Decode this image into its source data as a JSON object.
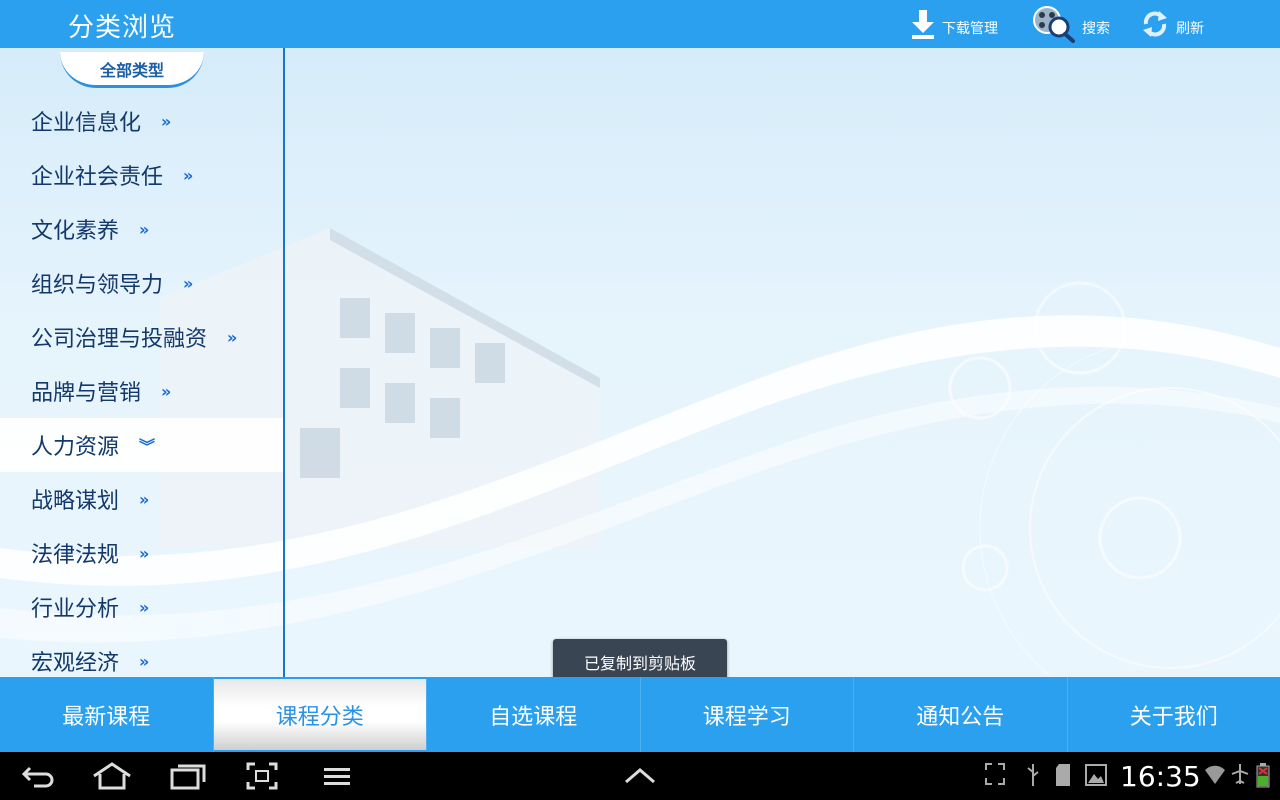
{
  "header": {
    "title": "分类浏览",
    "download_label": "下载管理",
    "search_label": "搜索",
    "refresh_label": "刷新"
  },
  "sidebar": {
    "badge": "全部类型",
    "items": [
      {
        "label": "企业信息化",
        "chevron": "»"
      },
      {
        "label": "企业社会责任",
        "chevron": "»"
      },
      {
        "label": "文化素养",
        "chevron": "»"
      },
      {
        "label": "组织与领导力",
        "chevron": "»"
      },
      {
        "label": "公司治理与投融资",
        "chevron": "»"
      },
      {
        "label": "品牌与营销",
        "chevron": "»"
      },
      {
        "label": "人力资源",
        "chevron": "︾"
      },
      {
        "label": "战略谋划",
        "chevron": "»"
      },
      {
        "label": "法律法规",
        "chevron": "»"
      },
      {
        "label": "行业分析",
        "chevron": "»"
      },
      {
        "label": "宏观经济",
        "chevron": "»"
      }
    ]
  },
  "toast": "已复制到剪贴板",
  "tabs": [
    {
      "label": "最新课程"
    },
    {
      "label": "课程分类"
    },
    {
      "label": "自选课程"
    },
    {
      "label": "课程学习"
    },
    {
      "label": "通知公告"
    },
    {
      "label": "关于我们"
    }
  ],
  "system": {
    "clock": "16:35"
  },
  "colors": {
    "primary": "#2aa0ef",
    "nav_text": "#13386b",
    "system_bar": "#000000"
  }
}
